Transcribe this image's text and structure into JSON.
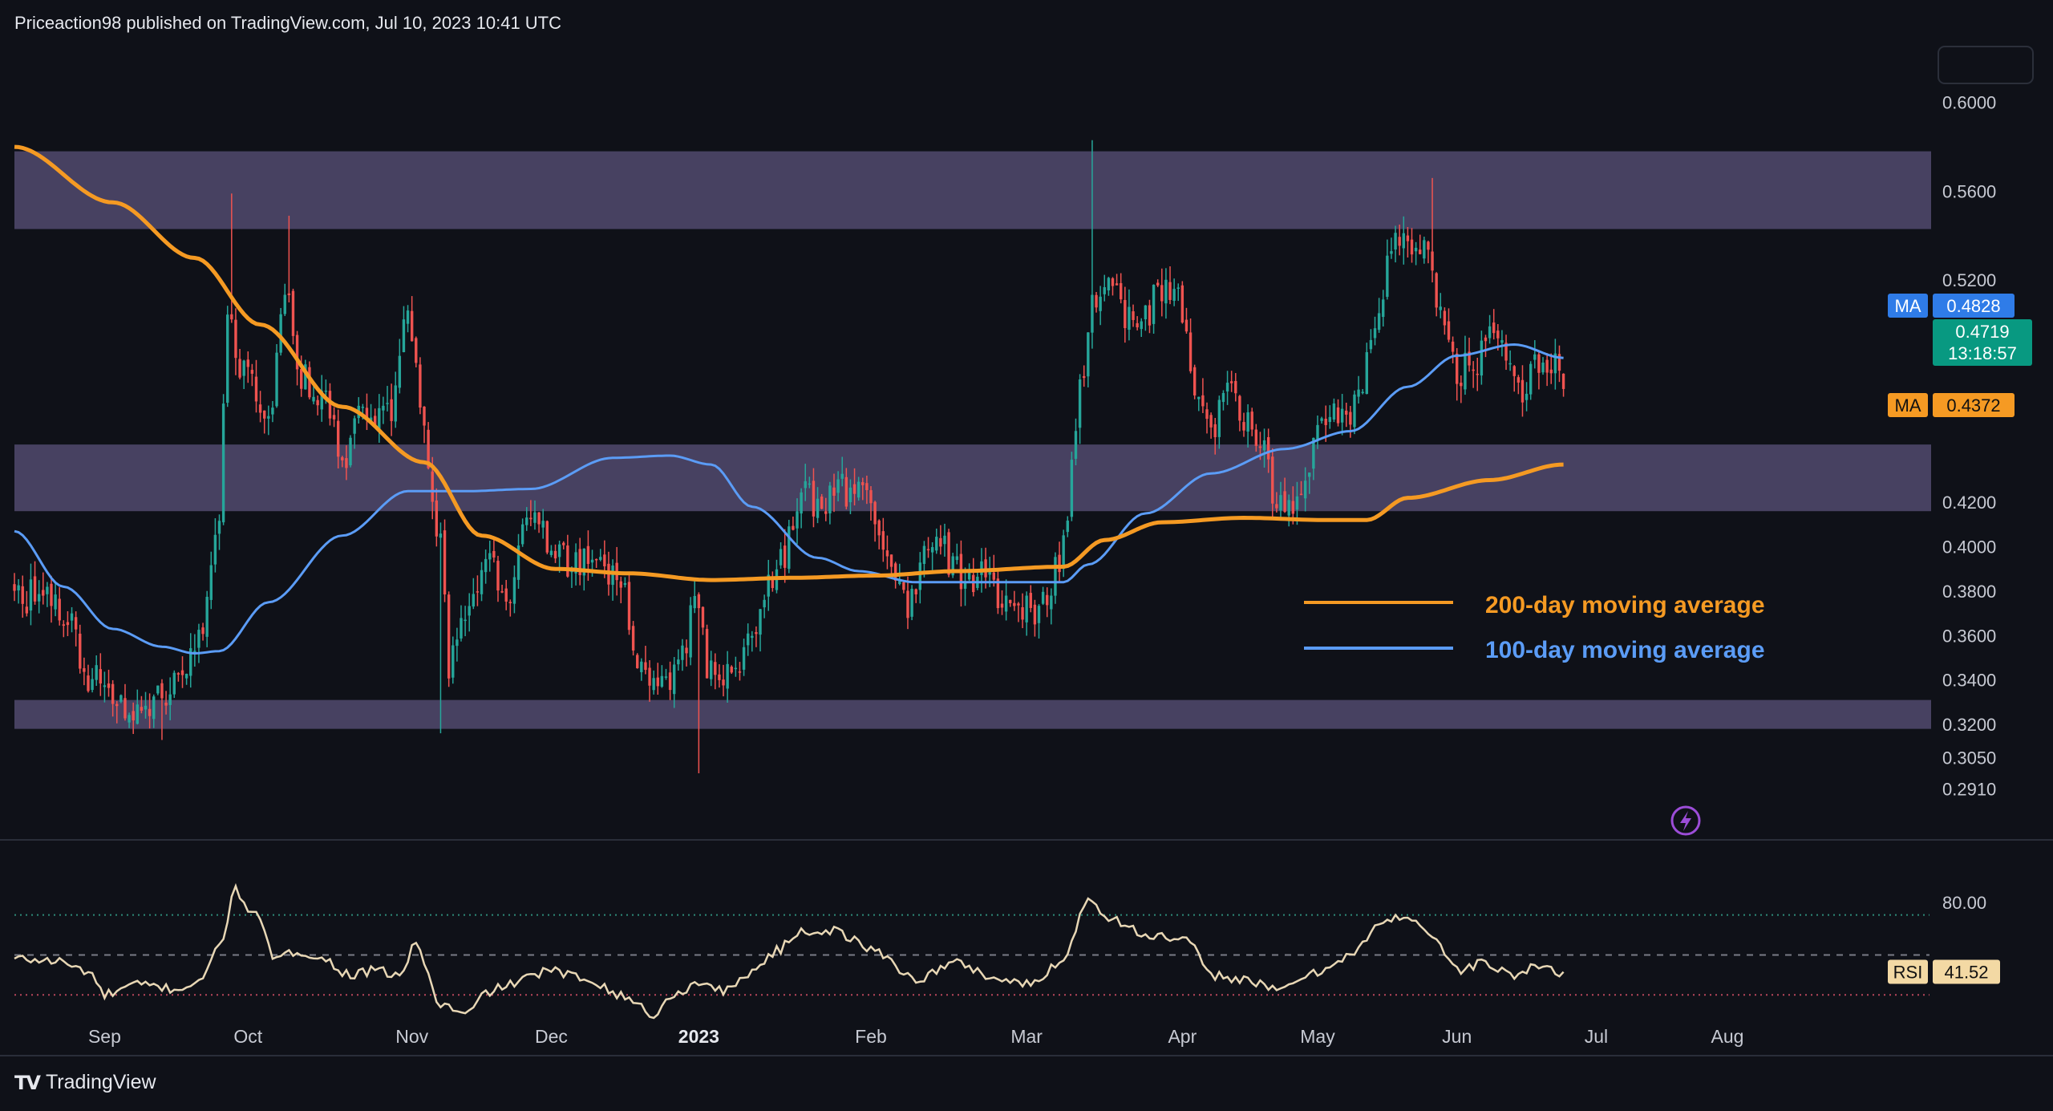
{
  "header": {
    "text": "Priceaction98 published on TradingView.com, Jul 10, 2023 10:41 UTC"
  },
  "footer": {
    "brand": "TradingView",
    "logo": "tradingview-logo-icon"
  },
  "colors": {
    "background": "#0f1118",
    "up": "#26a69a",
    "down": "#ef5350",
    "ma200": "#f59a23",
    "ma100": "#5b9cf6",
    "zone": "#4b4565",
    "rsi_line": "#e8d7b5",
    "price_badge": "#089981",
    "ma100_badge": "#2f7ce8",
    "ma200_badge": "#f59a23"
  },
  "chart_data": [
    {
      "type": "candlestick",
      "title": "",
      "price_axis_ticks": [
        "0.6000",
        "0.5600",
        "0.5200",
        "0.4200",
        "0.4000",
        "0.3800",
        "0.3600",
        "0.3400",
        "0.3200",
        "0.3050",
        "0.2910"
      ],
      "y_range": [
        0.285,
        0.61
      ],
      "x_ticks": [
        "Sep",
        "Oct",
        "Nov",
        "Dec",
        "2023",
        "Feb",
        "Mar",
        "Apr",
        "May",
        "Jun",
        "Jul",
        "Aug"
      ],
      "zones": [
        {
          "name": "upper-resistance-zone",
          "low": 0.543,
          "high": 0.578
        },
        {
          "name": "middle-support-zone",
          "low": 0.416,
          "high": 0.446
        },
        {
          "name": "lower-support-zone",
          "low": 0.318,
          "high": 0.331
        }
      ],
      "price_anchors": [
        [
          0,
          0.377
        ],
        [
          6,
          0.378
        ],
        [
          12,
          0.372
        ],
        [
          18,
          0.343
        ],
        [
          24,
          0.333
        ],
        [
          30,
          0.326
        ],
        [
          36,
          0.33
        ],
        [
          42,
          0.345
        ],
        [
          46,
          0.368
        ],
        [
          50,
          0.415
        ],
        [
          52,
          0.505
        ],
        [
          56,
          0.48
        ],
        [
          62,
          0.455
        ],
        [
          66,
          0.515
        ],
        [
          70,
          0.475
        ],
        [
          76,
          0.47
        ],
        [
          80,
          0.44
        ],
        [
          86,
          0.462
        ],
        [
          92,
          0.458
        ],
        [
          96,
          0.505
        ],
        [
          100,
          0.448
        ],
        [
          104,
          0.405
        ],
        [
          106,
          0.345
        ],
        [
          110,
          0.37
        ],
        [
          116,
          0.392
        ],
        [
          120,
          0.372
        ],
        [
          124,
          0.41
        ],
        [
          130,
          0.405
        ],
        [
          136,
          0.393
        ],
        [
          142,
          0.39
        ],
        [
          148,
          0.382
        ],
        [
          152,
          0.348
        ],
        [
          158,
          0.341
        ],
        [
          162,
          0.343
        ],
        [
          166,
          0.377
        ],
        [
          170,
          0.343
        ],
        [
          176,
          0.345
        ],
        [
          180,
          0.365
        ],
        [
          184,
          0.384
        ],
        [
          188,
          0.397
        ],
        [
          192,
          0.428
        ],
        [
          196,
          0.418
        ],
        [
          202,
          0.425
        ],
        [
          206,
          0.425
        ],
        [
          212,
          0.405
        ],
        [
          218,
          0.372
        ],
        [
          222,
          0.398
        ],
        [
          226,
          0.4
        ],
        [
          230,
          0.388
        ],
        [
          236,
          0.386
        ],
        [
          242,
          0.378
        ],
        [
          248,
          0.372
        ],
        [
          252,
          0.378
        ],
        [
          256,
          0.4
        ],
        [
          260,
          0.47
        ],
        [
          264,
          0.515
        ],
        [
          268,
          0.523
        ],
        [
          272,
          0.5
        ],
        [
          276,
          0.505
        ],
        [
          280,
          0.515
        ],
        [
          284,
          0.513
        ],
        [
          288,
          0.466
        ],
        [
          292,
          0.452
        ],
        [
          296,
          0.47
        ],
        [
          300,
          0.455
        ],
        [
          304,
          0.446
        ],
        [
          308,
          0.422
        ],
        [
          312,
          0.42
        ],
        [
          316,
          0.438
        ],
        [
          320,
          0.46
        ],
        [
          324,
          0.455
        ],
        [
          328,
          0.47
        ],
        [
          332,
          0.505
        ],
        [
          336,
          0.533
        ],
        [
          340,
          0.538
        ],
        [
          344,
          0.532
        ],
        [
          348,
          0.505
        ],
        [
          352,
          0.477
        ],
        [
          356,
          0.483
        ],
        [
          360,
          0.495
        ],
        [
          364,
          0.486
        ],
        [
          368,
          0.47
        ],
        [
          372,
          0.484
        ],
        [
          376,
          0.48
        ],
        [
          378,
          0.471
        ]
      ],
      "wick_extremes": [
        {
          "index": 53,
          "high": 0.559
        },
        {
          "index": 67,
          "high": 0.549
        },
        {
          "index": 104,
          "low": 0.316
        },
        {
          "index": 167,
          "low": 0.298
        },
        {
          "index": 263,
          "high": 0.583
        },
        {
          "index": 346,
          "high": 0.566
        },
        {
          "index": 36,
          "low": 0.313
        }
      ],
      "ma200_anchors": [
        [
          0,
          0.58
        ],
        [
          24,
          0.555
        ],
        [
          44,
          0.53
        ],
        [
          60,
          0.5
        ],
        [
          80,
          0.463
        ],
        [
          100,
          0.438
        ],
        [
          114,
          0.405
        ],
        [
          132,
          0.39
        ],
        [
          150,
          0.388
        ],
        [
          170,
          0.385
        ],
        [
          190,
          0.386
        ],
        [
          210,
          0.387
        ],
        [
          230,
          0.389
        ],
        [
          256,
          0.391
        ],
        [
          266,
          0.403
        ],
        [
          280,
          0.411
        ],
        [
          300,
          0.413
        ],
        [
          320,
          0.412
        ],
        [
          330,
          0.412
        ],
        [
          340,
          0.422
        ],
        [
          360,
          0.43
        ],
        [
          378,
          0.437
        ]
      ],
      "ma100_anchors": [
        [
          0,
          0.407
        ],
        [
          12,
          0.382
        ],
        [
          24,
          0.363
        ],
        [
          36,
          0.355
        ],
        [
          44,
          0.352
        ],
        [
          50,
          0.353
        ],
        [
          62,
          0.375
        ],
        [
          80,
          0.405
        ],
        [
          96,
          0.425
        ],
        [
          110,
          0.425
        ],
        [
          126,
          0.426
        ],
        [
          146,
          0.44
        ],
        [
          160,
          0.441
        ],
        [
          170,
          0.437
        ],
        [
          180,
          0.418
        ],
        [
          196,
          0.395
        ],
        [
          206,
          0.389
        ],
        [
          220,
          0.384
        ],
        [
          236,
          0.384
        ],
        [
          256,
          0.384
        ],
        [
          262,
          0.392
        ],
        [
          276,
          0.415
        ],
        [
          292,
          0.433
        ],
        [
          310,
          0.444
        ],
        [
          326,
          0.452
        ],
        [
          340,
          0.472
        ],
        [
          352,
          0.486
        ],
        [
          366,
          0.491
        ],
        [
          378,
          0.485
        ]
      ],
      "legend": [
        {
          "label": "200-day moving average",
          "color": "#f59a23"
        },
        {
          "label": "100-day moving average",
          "color": "#5b9cf6"
        }
      ],
      "badges": {
        "ma100": {
          "label": "MA",
          "value": "0.4828"
        },
        "price": {
          "value": "0.4719",
          "countdown": "13:18:57"
        },
        "ma200": {
          "label": "MA",
          "value": "0.4372"
        }
      }
    },
    {
      "type": "line",
      "title": "RSI",
      "y_range": [
        10,
        100
      ],
      "ticks": [
        "80.00"
      ],
      "levels": {
        "upper": 70,
        "middle": 50,
        "lower": 30
      },
      "current": {
        "label": "RSI",
        "value": "41.52"
      },
      "rsi_anchors": [
        [
          0,
          48
        ],
        [
          10,
          47
        ],
        [
          18,
          42
        ],
        [
          22,
          30
        ],
        [
          30,
          35
        ],
        [
          40,
          33
        ],
        [
          46,
          38
        ],
        [
          50,
          55
        ],
        [
          54,
          82
        ],
        [
          58,
          72
        ],
        [
          64,
          48
        ],
        [
          70,
          52
        ],
        [
          76,
          47
        ],
        [
          82,
          40
        ],
        [
          88,
          42
        ],
        [
          94,
          40
        ],
        [
          98,
          55
        ],
        [
          104,
          25
        ],
        [
          110,
          20
        ],
        [
          116,
          32
        ],
        [
          122,
          36
        ],
        [
          130,
          42
        ],
        [
          140,
          38
        ],
        [
          150,
          28
        ],
        [
          156,
          20
        ],
        [
          162,
          32
        ],
        [
          168,
          36
        ],
        [
          174,
          32
        ],
        [
          180,
          42
        ],
        [
          186,
          52
        ],
        [
          192,
          62
        ],
        [
          200,
          62
        ],
        [
          210,
          52
        ],
        [
          220,
          38
        ],
        [
          230,
          46
        ],
        [
          240,
          38
        ],
        [
          248,
          35
        ],
        [
          256,
          48
        ],
        [
          262,
          78
        ],
        [
          268,
          68
        ],
        [
          276,
          60
        ],
        [
          286,
          57
        ],
        [
          292,
          40
        ],
        [
          300,
          38
        ],
        [
          308,
          32
        ],
        [
          316,
          40
        ],
        [
          326,
          50
        ],
        [
          334,
          66
        ],
        [
          340,
          70
        ],
        [
          346,
          60
        ],
        [
          352,
          42
        ],
        [
          358,
          46
        ],
        [
          366,
          40
        ],
        [
          372,
          44
        ],
        [
          378,
          41.5
        ]
      ]
    }
  ]
}
